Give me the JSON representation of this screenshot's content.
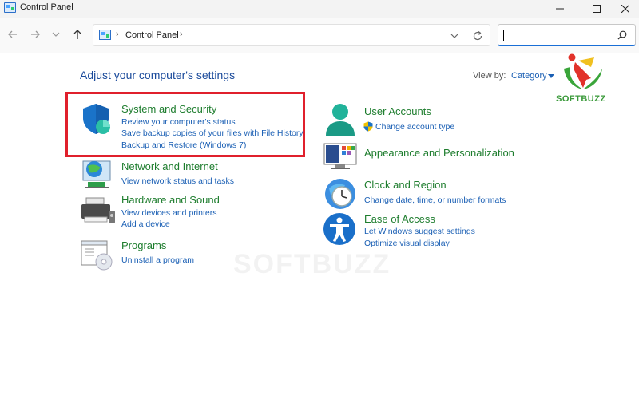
{
  "window": {
    "title": "Control Panel"
  },
  "address": {
    "path": "Control Panel"
  },
  "search": {
    "value": ""
  },
  "header": {
    "title": "Adjust your computer's settings",
    "view_by_label": "View by:",
    "view_by_value": "Category"
  },
  "categories": {
    "system_security": {
      "title": "System and Security",
      "links": [
        "Review your computer's status",
        "Save backup copies of your files with File History",
        "Backup and Restore (Windows 7)"
      ]
    },
    "network": {
      "title": "Network and Internet",
      "links": [
        "View network status and tasks"
      ]
    },
    "hardware": {
      "title": "Hardware and Sound",
      "links": [
        "View devices and printers",
        "Add a device"
      ]
    },
    "programs": {
      "title": "Programs",
      "links": [
        "Uninstall a program"
      ]
    },
    "user_accounts": {
      "title": "User Accounts",
      "links": [
        "Change account type"
      ]
    },
    "appearance": {
      "title": "Appearance and Personalization",
      "links": []
    },
    "clock": {
      "title": "Clock and Region",
      "links": [
        "Change date, time, or number formats"
      ]
    },
    "ease": {
      "title": "Ease of Access",
      "links": [
        "Let Windows suggest settings",
        "Optimize visual display"
      ]
    }
  },
  "branding": {
    "logo_text": "SOFTBUZZ",
    "watermark": "SOFTBUZZ"
  },
  "colors": {
    "link": "#1a5fb4",
    "category_title": "#1e7d2e",
    "page_title": "#1a4a9b",
    "highlight": "#e0202c"
  }
}
